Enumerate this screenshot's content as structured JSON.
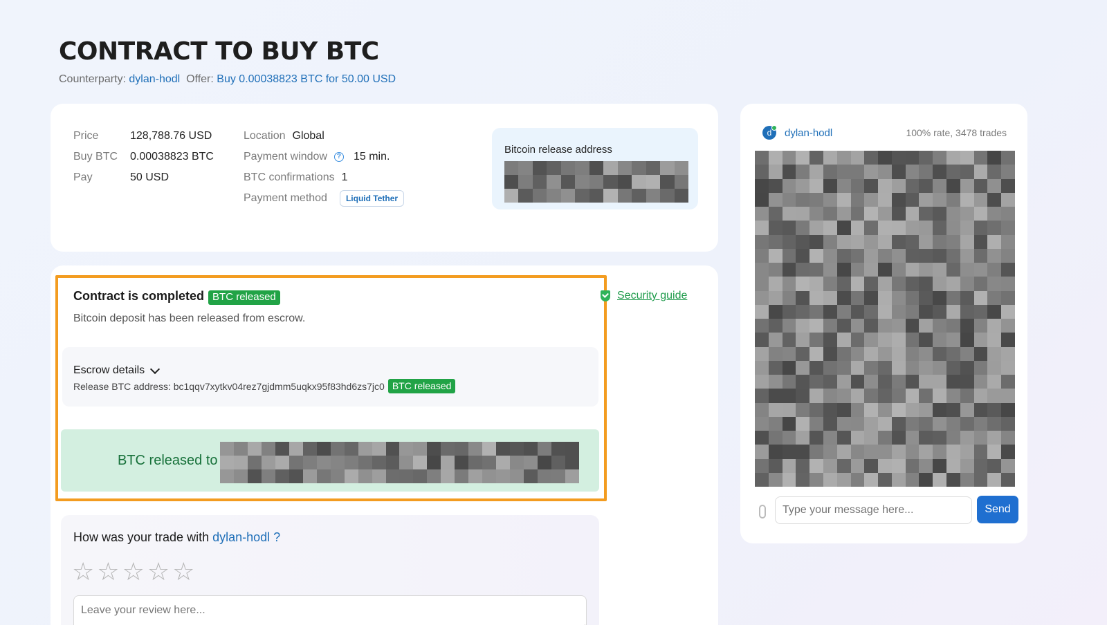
{
  "header": {
    "title": "CONTRACT TO BUY BTC",
    "counterparty_label": "Counterparty:",
    "counterparty": "dylan-hodl",
    "offer_label": "Offer:",
    "offer": "Buy 0.00038823 BTC for 50.00 USD"
  },
  "info": {
    "left": [
      {
        "k": "Price",
        "v": "128,788.76 USD"
      },
      {
        "k": "Buy BTC",
        "v": "0.00038823 BTC"
      },
      {
        "k": "Pay",
        "v": "50 USD"
      }
    ],
    "location_label": "Location",
    "location": "Global",
    "payment_window_label": "Payment window",
    "payment_window": "15 min.",
    "confirmations_label": "BTC confirmations",
    "confirmations": "1",
    "payment_method_label": "Payment method",
    "payment_method": "Liquid Tether",
    "release_address_label": "Bitcoin release address"
  },
  "contract": {
    "status": "Contract is completed",
    "status_badge": "BTC released",
    "description": "Bitcoin deposit has been released from escrow.",
    "security_guide": "Security guide",
    "escrow_title": "Escrow details",
    "escrow_address_label": "Release BTC address:",
    "escrow_address": "bc1qqv7xytkv04rez7gjdmm5uqkx95f83hd6zs7jc0",
    "escrow_badge": "BTC released",
    "released_to_label": "BTC released to"
  },
  "review": {
    "question_prefix": "How was your trade with",
    "question_user": "dylan-hodl ?",
    "rating": 0,
    "max_rating": 5,
    "placeholder": "Leave your review here..."
  },
  "chat": {
    "avatar_letter": "d",
    "user": "dylan-hodl",
    "stats": "100% rate, 3478 trades",
    "placeholder": "Type your message here...",
    "send_label": "Send"
  },
  "colors": {
    "accent": "#1f6fb8",
    "success": "#21a346",
    "highlight": "#f39c20",
    "released_bg": "#d3efe0"
  }
}
